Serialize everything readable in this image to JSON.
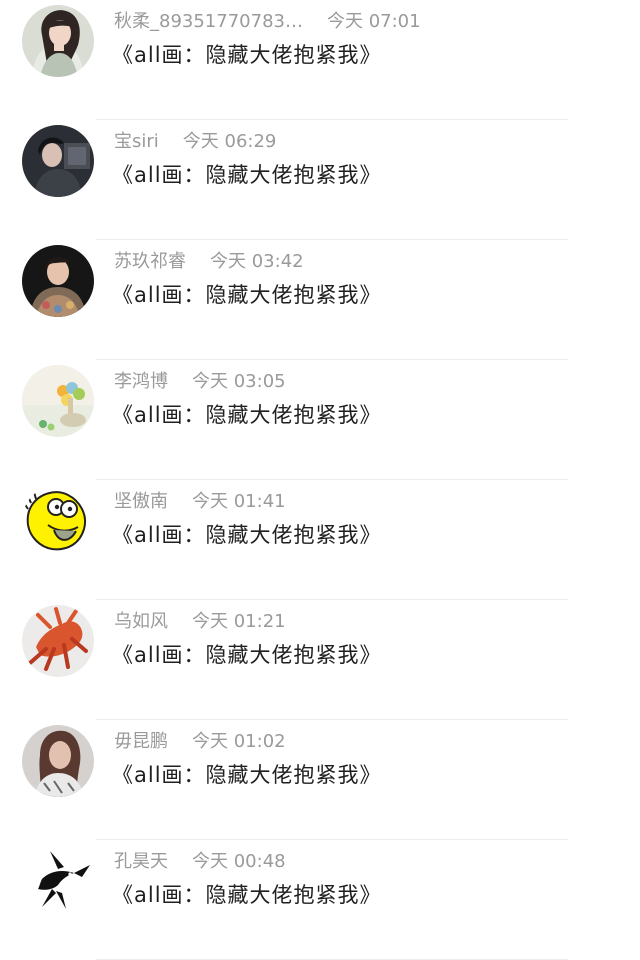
{
  "comments": [
    {
      "username": "秋柔_89351770783…",
      "time": "今天 07:01",
      "text": "《all画：隐藏大佬抱紧我》",
      "avatar_icon": "girl-portrait-icon"
    },
    {
      "username": "宝siri",
      "time": "今天 06:29",
      "text": "《all画：隐藏大佬抱紧我》",
      "avatar_icon": "boy-portrait-icon"
    },
    {
      "username": "苏玖祁睿",
      "time": "今天 03:42",
      "text": "《all画：隐藏大佬抱紧我》",
      "avatar_icon": "man-portrait-icon"
    },
    {
      "username": "李鸿博",
      "time": "今天 03:05",
      "text": "《all画：隐藏大佬抱紧我》",
      "avatar_icon": "candy-icon"
    },
    {
      "username": "坚傲南",
      "time": "今天 01:41",
      "text": "《all画：隐藏大佬抱紧我》",
      "avatar_icon": "cartoon-face-icon"
    },
    {
      "username": "乌如风",
      "time": "今天 01:21",
      "text": "《all画：隐藏大佬抱紧我》",
      "avatar_icon": "flower-icon"
    },
    {
      "username": "毋昆鹏",
      "time": "今天 01:02",
      "text": "《all画：隐藏大佬抱紧我》",
      "avatar_icon": "woman-portrait-icon"
    },
    {
      "username": "孔昊天",
      "time": "今天 00:48",
      "text": "《all画：隐藏大佬抱紧我》",
      "avatar_icon": "swallow-icon"
    }
  ]
}
